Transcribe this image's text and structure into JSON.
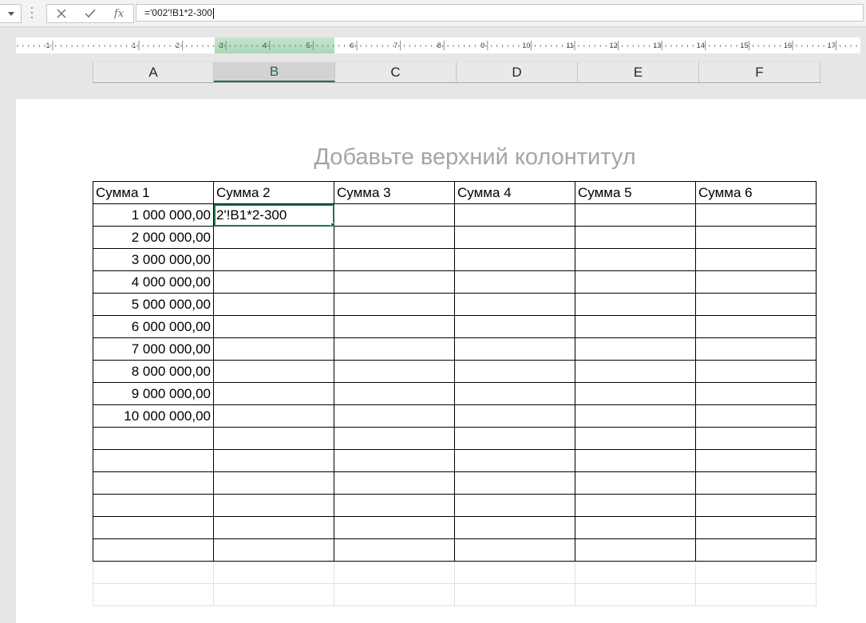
{
  "formula_bar": {
    "formula": "='002'!B1*2-300",
    "fx_label": "fx"
  },
  "ruler": {
    "labels": [
      "1",
      "1",
      "2",
      "3",
      "4",
      "5",
      "6",
      "7",
      "8",
      "9",
      "10",
      "11",
      "12",
      "13",
      "14",
      "15",
      "16",
      "17"
    ]
  },
  "columns": [
    {
      "letter": "A",
      "selected": false
    },
    {
      "letter": "B",
      "selected": true
    },
    {
      "letter": "C",
      "selected": false
    },
    {
      "letter": "D",
      "selected": false
    },
    {
      "letter": "E",
      "selected": false
    },
    {
      "letter": "F",
      "selected": false
    }
  ],
  "page": {
    "header_placeholder": "Добавьте верхний колонтитул"
  },
  "table": {
    "headers": [
      "Сумма 1",
      "Сумма 2",
      "Сумма 3",
      "Сумма 4",
      "Сумма 5",
      "Сумма 6"
    ],
    "rows": [
      [
        "1 000 000,00",
        "2'!B1*2-300",
        "",
        "",
        "",
        ""
      ],
      [
        "2 000 000,00",
        "",
        "",
        "",
        "",
        ""
      ],
      [
        "3 000 000,00",
        "",
        "",
        "",
        "",
        ""
      ],
      [
        "4 000 000,00",
        "",
        "",
        "",
        "",
        ""
      ],
      [
        "5 000 000,00",
        "",
        "",
        "",
        "",
        ""
      ],
      [
        "6 000 000,00",
        "",
        "",
        "",
        "",
        ""
      ],
      [
        "7 000 000,00",
        "",
        "",
        "",
        "",
        ""
      ],
      [
        "8 000 000,00",
        "",
        "",
        "",
        "",
        ""
      ],
      [
        "9 000 000,00",
        "",
        "",
        "",
        "",
        ""
      ],
      [
        "10 000 000,00",
        "",
        "",
        "",
        "",
        ""
      ],
      [
        "",
        "",
        "",
        "",
        "",
        ""
      ],
      [
        "",
        "",
        "",
        "",
        "",
        ""
      ],
      [
        "",
        "",
        "",
        "",
        "",
        ""
      ],
      [
        "",
        "",
        "",
        "",
        "",
        ""
      ],
      [
        "",
        "",
        "",
        "",
        "",
        ""
      ],
      [
        "",
        "",
        "",
        "",
        "",
        ""
      ]
    ],
    "pale_rows": 2,
    "active_cell": {
      "row": 0,
      "col": 1
    }
  },
  "colors": {
    "accent": "#217346",
    "selected_header_bg": "#d3d3d3",
    "ruler_band": "#a8d8b6",
    "placeholder_text": "#a5a5a5"
  }
}
